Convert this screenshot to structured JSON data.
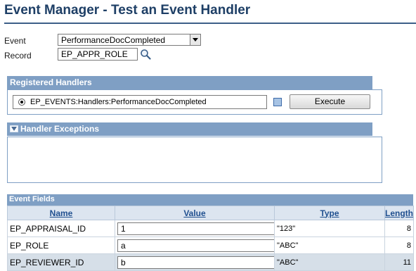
{
  "page": {
    "title": "Event Manager - Test an Event Handler"
  },
  "form": {
    "event_label": "Event",
    "event_value": "PerformanceDocCompleted",
    "record_label": "Record",
    "record_value": "EP_APPR_ROLE"
  },
  "registered_handlers": {
    "title": "Registered Handlers",
    "handler": "EP_EVENTS:Handlers:PerformanceDocCompleted",
    "execute_label": "Execute"
  },
  "handler_exceptions": {
    "title": "Handler Exceptions"
  },
  "event_fields": {
    "title": "Event Fields",
    "columns": [
      "Name",
      "Value",
      "Type",
      "Length"
    ],
    "rows": [
      {
        "name": "EP_APPRAISAL_ID",
        "value": "1",
        "type": "\"123\"",
        "length": "8"
      },
      {
        "name": "EP_ROLE",
        "value": "a",
        "type": "\"ABC\"",
        "length": "8"
      },
      {
        "name": "EP_REVIEWER_ID",
        "value": "b",
        "type": "\"ABC\"",
        "length": "11"
      }
    ]
  },
  "colors": {
    "title": "#1e3f66",
    "section_header": "#7f9fc4",
    "grid_header_bg": "#dce5f0",
    "grid_header_text": "#1f4f8f",
    "highlight_row": "#d6dfe8"
  },
  "icons": {
    "lookup": "magnifier-icon",
    "exceptions_toggle": "collapse-triangle-icon"
  }
}
